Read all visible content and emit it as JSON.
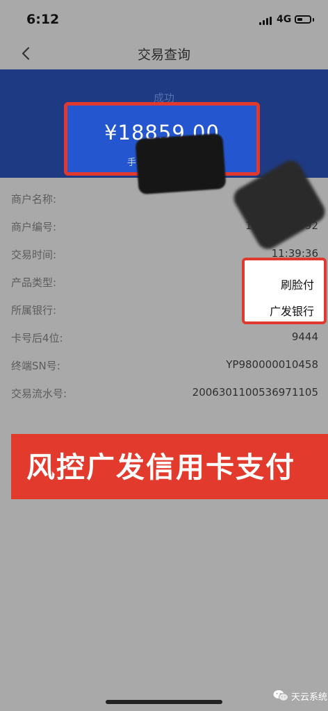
{
  "status_bar": {
    "time": "6:12",
    "network": "4G"
  },
  "nav": {
    "title": "交易查询"
  },
  "transaction": {
    "status": "成功",
    "amount": "¥18859.00",
    "amount_sub": "手"
  },
  "details": [
    {
      "label": "商户名称:",
      "value": ""
    },
    {
      "label": "商户编号:",
      "value": "10085279992"
    },
    {
      "label": "交易时间:",
      "value": "11:39:36"
    },
    {
      "label": "产品类型:",
      "value": "刷脸付"
    },
    {
      "label": "所属银行:",
      "value": "广发银行"
    },
    {
      "label": "卡号后4位:",
      "value": "9444"
    },
    {
      "label": "终端SN号:",
      "value": "YP980000010458"
    },
    {
      "label": "交易流水号:",
      "value": "2006301100536971105"
    }
  ],
  "banner": {
    "text": "风控广发信用卡支付"
  },
  "watermark": {
    "text": "天云系统"
  },
  "colors": {
    "header": "#1e3a82",
    "amount_bg": "#2457cf",
    "highlight_red": "#e03a30",
    "banner_red": "#e23a2c",
    "page_bg": "#a9a9a9"
  },
  "icons": {
    "back": "chevron-left-icon",
    "watermark": "wechat-icon"
  }
}
